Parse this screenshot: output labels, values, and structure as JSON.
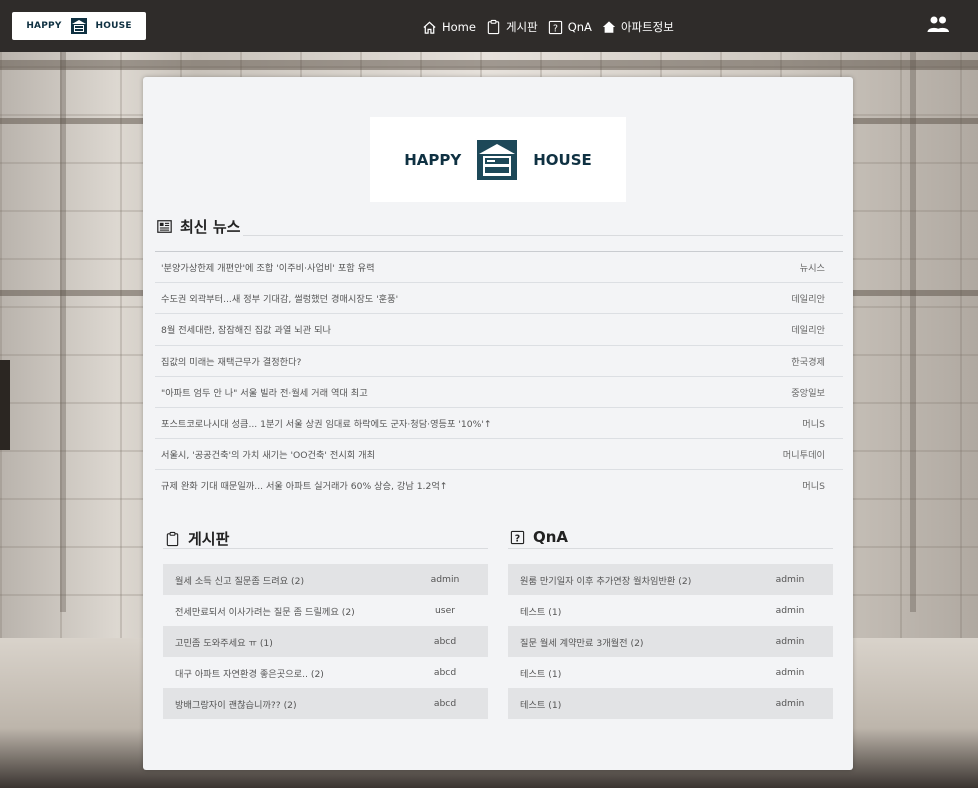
{
  "brand": {
    "left_text": "HAPPY",
    "right_text": "HOUSE"
  },
  "nav": {
    "items": [
      {
        "label": "Home",
        "icon": "home-icon"
      },
      {
        "label": "게시판",
        "icon": "clipboard-icon"
      },
      {
        "label": "QnA",
        "icon": "question-icon"
      },
      {
        "label": "아파트정보",
        "icon": "house-fill-icon"
      }
    ],
    "user_icon": "people-icon"
  },
  "logo": {
    "left_text": "HAPPY",
    "right_text": "HOUSE"
  },
  "news": {
    "title": "최신 뉴스",
    "items": [
      {
        "headline": "'분양가상한제 개편안'에 조합 '이주비·사업비' 포함 유력",
        "source": "뉴시스"
      },
      {
        "headline": "수도권 외곽부터...새 정부 기대감, 썰렁했던 경매시장도 '훈풍'",
        "source": "데일리안"
      },
      {
        "headline": "8월 전세대란, 잠잠해진 집값 과열 뇌관 되나",
        "source": "데일리안"
      },
      {
        "headline": "집값의 미래는 재택근무가 결정한다?",
        "source": "한국경제"
      },
      {
        "headline": "\"아파트 엄두 안 나\" 서울 빌라 전·월세 거래 역대 최고",
        "source": "중앙일보"
      },
      {
        "headline": "포스트코로나시대 성큼... 1분기 서울 상권 임대료 하락에도 군자·청담·영등포 '10%'↑",
        "source": "머니S"
      },
      {
        "headline": "서울시, '공공건축'의 가치 새기는 'OO건축' 전시회 개최",
        "source": "머니투데이"
      },
      {
        "headline": "규제 완화 기대 때문일까... 서울 아파트 실거래가 60% 상승, 강남 1.2억↑",
        "source": "머니S"
      }
    ]
  },
  "board": {
    "title": "게시판",
    "items": [
      {
        "title": "월세 소득 신고 질문좀 드려요 (2)",
        "author": "admin"
      },
      {
        "title": "전세만료되서 이사가려는 질문 좀 드릴께요 (2)",
        "author": "user"
      },
      {
        "title": "고민좀 도와주세요 ㅠ (1)",
        "author": "abcd"
      },
      {
        "title": "대구 아파트 자연환경 좋은곳으로.. (2)",
        "author": "abcd"
      },
      {
        "title": "방배그랑자이 괜찮습니까?? (2)",
        "author": "abcd"
      }
    ]
  },
  "qna": {
    "title": "QnA",
    "items": [
      {
        "title": "원룸 만기일자 이후 추가연장 월차임반환 (2)",
        "author": "admin"
      },
      {
        "title": "테스트 (1)",
        "author": "admin"
      },
      {
        "title": "질문 월세 계약만료 3개월전 (2)",
        "author": "admin"
      },
      {
        "title": "테스트 (1)",
        "author": "admin"
      },
      {
        "title": "테스트 (1)",
        "author": "admin"
      }
    ]
  }
}
